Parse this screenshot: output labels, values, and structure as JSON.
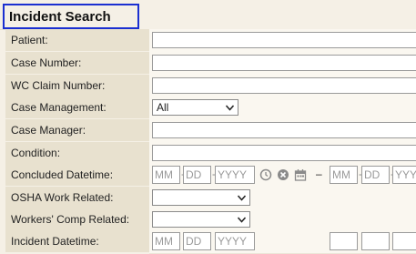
{
  "header": {
    "title": "Incident Search"
  },
  "fields": {
    "patient": {
      "label": "Patient:"
    },
    "case_number": {
      "label": "Case Number:"
    },
    "wc_claim_number": {
      "label": "WC Claim Number:"
    },
    "case_management": {
      "label": "Case Management:",
      "selected": "All"
    },
    "case_manager": {
      "label": "Case Manager:"
    },
    "condition": {
      "label": "Condition:"
    },
    "concluded_datetime": {
      "label": "Concluded Datetime:",
      "mm": "MM",
      "dd": "DD",
      "yyyy": "YYYY",
      "range_sep": "–"
    },
    "osha_work_related": {
      "label": "OSHA Work Related:",
      "selected": ""
    },
    "workers_comp_related": {
      "label": "Workers' Comp Related:",
      "selected": ""
    },
    "incident_datetime": {
      "label": "Incident Datetime:",
      "mm": "MM",
      "dd": "DD",
      "yyyy": "YYYY"
    }
  },
  "icons": {
    "clock": "clock-icon",
    "clear": "clear-icon",
    "calendar": "calendar-icon"
  }
}
